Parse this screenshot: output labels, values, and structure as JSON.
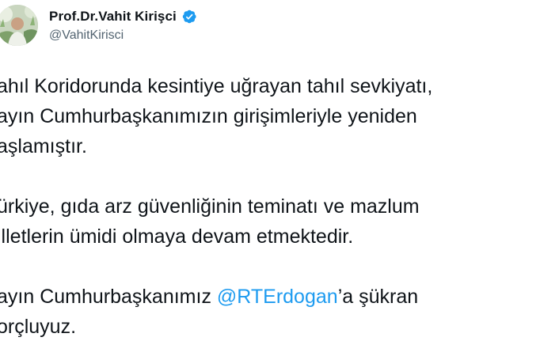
{
  "tweet": {
    "author": {
      "display_name": "Prof.Dr.Vahit Kirişci",
      "handle": "@VahitKirisci",
      "verified": true,
      "avatar": "profile-photo",
      "verified_icon": "verified-badge-icon"
    },
    "paragraphs": [
      {
        "lines": [
          "ahıl Koridorunda kesintiye uğrayan tahıl sevkiyatı,",
          "ayın Cumhurbaşkanımızın girişimleriyle yeniden",
          "aşlamıştır."
        ]
      },
      {
        "lines": [
          "ürkiye, gıda arz güvenliğinin teminatı ve mazlum",
          "illetlerin ümidi olmaya devam etmektedir."
        ]
      },
      {
        "line1_before": "ayın Cumhurbaşkanımız ",
        "mention": "@RTErdogan",
        "line1_after": "’a şükran",
        "line2": "orçluyuz."
      }
    ]
  },
  "colors": {
    "text": "#0f1419",
    "handle": "#536471",
    "mention": "#1d9bf0",
    "verified": "#1d9bf0",
    "background": "#ffffff"
  }
}
